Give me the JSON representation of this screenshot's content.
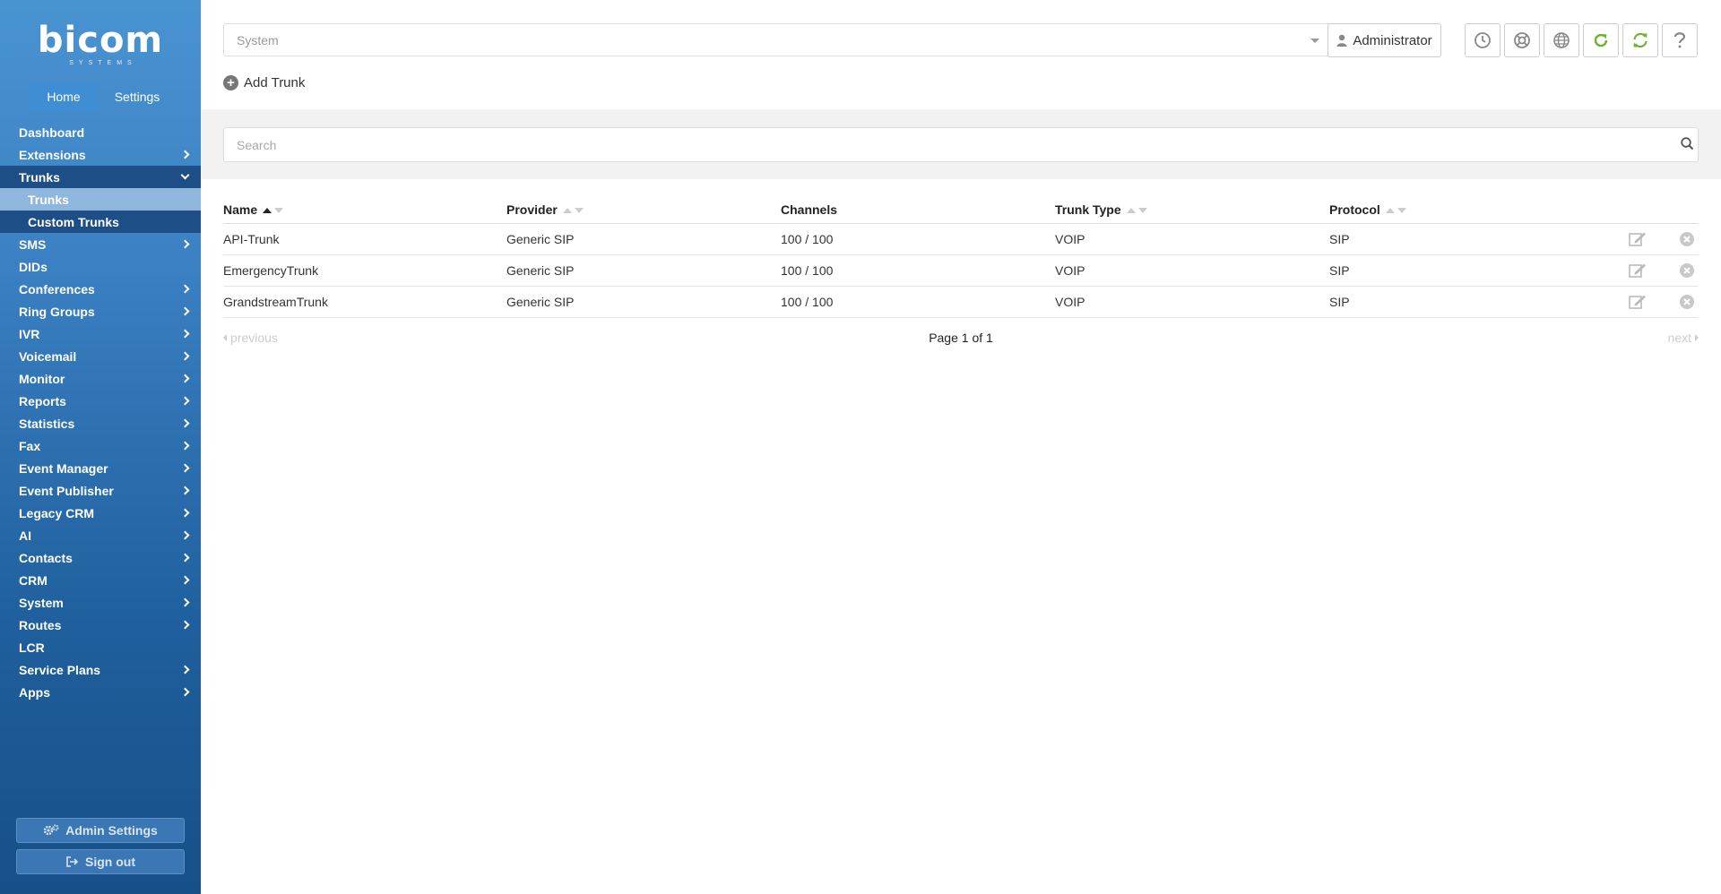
{
  "sidebar": {
    "logo": "bicom",
    "logo_sub": "SYSTEMS",
    "tabs": [
      {
        "label": "Home"
      },
      {
        "label": "Settings"
      }
    ],
    "items": [
      {
        "label": "Dashboard"
      },
      {
        "label": "Extensions"
      },
      {
        "label": "Trunks"
      },
      {
        "label": "Trunks"
      },
      {
        "label": "Custom Trunks"
      },
      {
        "label": "SMS"
      },
      {
        "label": "DIDs"
      },
      {
        "label": "Conferences"
      },
      {
        "label": "Ring Groups"
      },
      {
        "label": "IVR"
      },
      {
        "label": "Voicemail"
      },
      {
        "label": "Monitor"
      },
      {
        "label": "Reports"
      },
      {
        "label": "Statistics"
      },
      {
        "label": "Fax"
      },
      {
        "label": "Event Manager"
      },
      {
        "label": "Event Publisher"
      },
      {
        "label": "Legacy CRM"
      },
      {
        "label": "AI"
      },
      {
        "label": "Contacts"
      },
      {
        "label": "CRM"
      },
      {
        "label": "System"
      },
      {
        "label": "Routes"
      },
      {
        "label": "LCR"
      },
      {
        "label": "Service Plans"
      },
      {
        "label": "Apps"
      }
    ],
    "admin_settings_label": "Admin Settings",
    "sign_out_label": "Sign out"
  },
  "header": {
    "system_select_value": "System",
    "user_label": "Administrator",
    "icons": [
      "clock-icon",
      "support-icon",
      "globe-icon",
      "reload-icon",
      "sync-icon",
      "help-icon"
    ],
    "accent_green": "#6ab42d",
    "add_trunk_label": "Add Trunk"
  },
  "search": {
    "placeholder": "Search"
  },
  "table": {
    "columns": [
      {
        "label": "Name"
      },
      {
        "label": "Provider"
      },
      {
        "label": "Channels"
      },
      {
        "label": "Trunk Type"
      },
      {
        "label": "Protocol"
      }
    ],
    "rows": [
      {
        "name": "API-Trunk",
        "provider": "Generic SIP",
        "channels": "100 / 100",
        "type": "VOIP",
        "protocol": "SIP"
      },
      {
        "name": "EmergencyTrunk",
        "provider": "Generic SIP",
        "channels": "100 / 100",
        "type": "VOIP",
        "protocol": "SIP"
      },
      {
        "name": "GrandstreamTrunk",
        "provider": "Generic SIP",
        "channels": "100 / 100",
        "type": "VOIP",
        "protocol": "SIP"
      }
    ]
  },
  "pager": {
    "previous": "previous",
    "page_info": "Page 1 of 1",
    "next": "next"
  }
}
